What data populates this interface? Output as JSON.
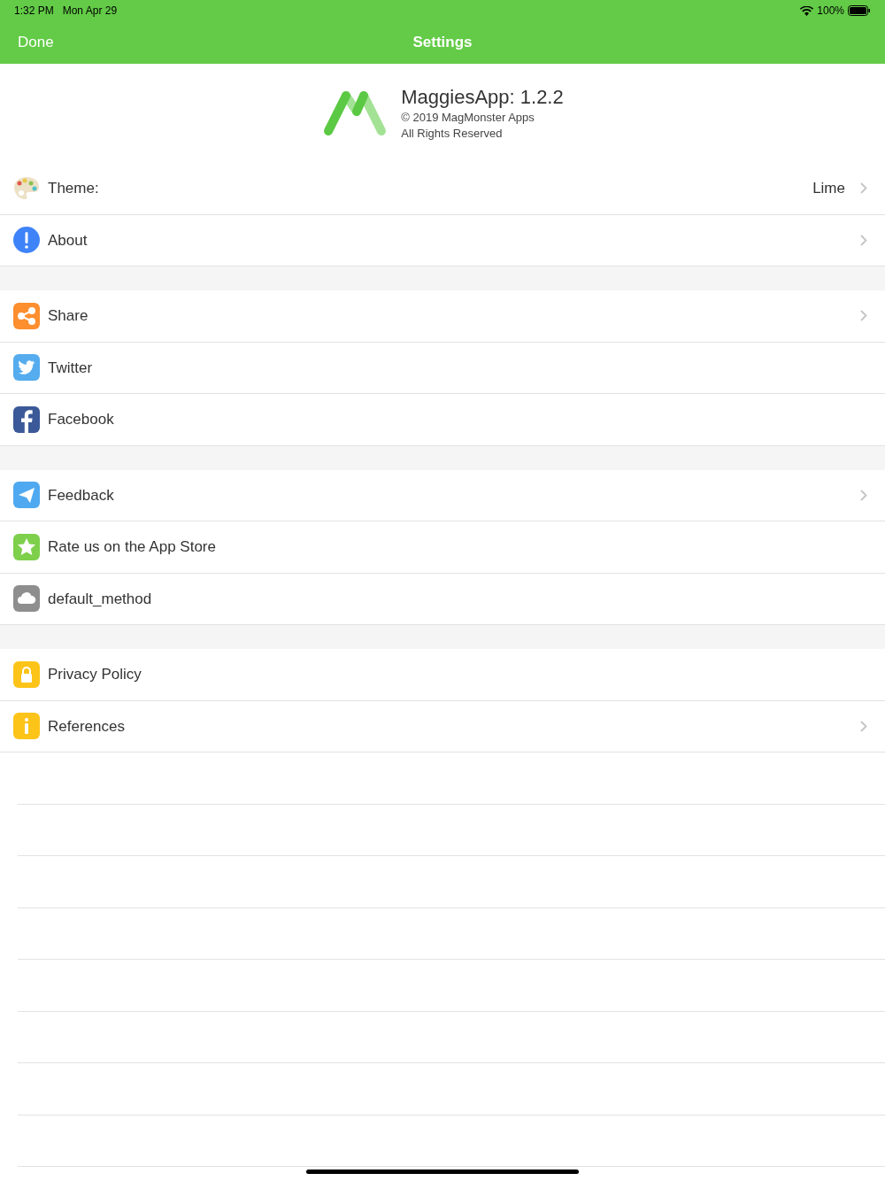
{
  "status_bar": {
    "time": "1:32 PM",
    "date": "Mon Apr 29",
    "battery": "100%"
  },
  "nav_bar": {
    "left_button": "Done",
    "title": "Settings"
  },
  "header": {
    "app_name": "MaggiesApp: 1.2.2",
    "copyright": "© 2019 MagMonster Apps",
    "rights": "All Rights Reserved"
  },
  "sections": [
    {
      "rows": [
        {
          "label": "Theme:",
          "value": "Lime",
          "chevron": true
        },
        {
          "label": "About",
          "chevron": true
        }
      ]
    },
    {
      "rows": [
        {
          "label": "Share",
          "chevron": true
        },
        {
          "label": "Twitter",
          "chevron": false
        },
        {
          "label": "Facebook",
          "chevron": false
        }
      ]
    },
    {
      "rows": [
        {
          "label": "Feedback",
          "chevron": true
        },
        {
          "label": "Rate us on the App Store",
          "chevron": false
        },
        {
          "label": "default_method",
          "chevron": false
        }
      ]
    },
    {
      "rows": [
        {
          "label": "Privacy Policy",
          "chevron": false
        },
        {
          "label": "References",
          "chevron": true
        }
      ]
    }
  ]
}
